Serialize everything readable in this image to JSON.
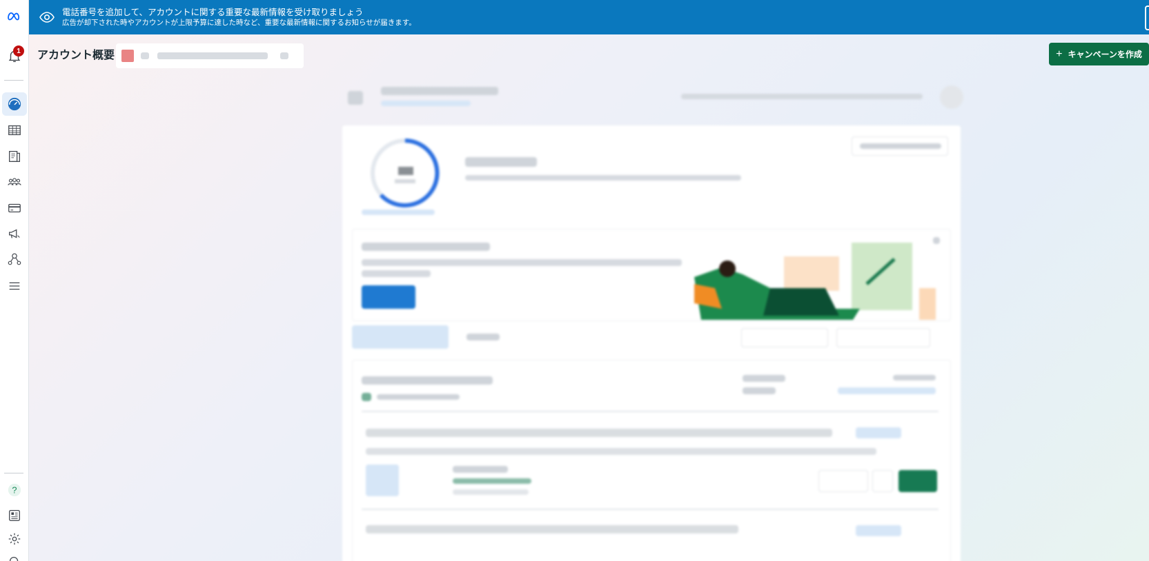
{
  "banner": {
    "line1": "電話番号を追加して、アカウントに関する重要な最新情報を受け取りましょう",
    "line2": "広告が却下された時やアカウントが上限予算に達した時など、重要な最新情報に関するお知らせが届きます。"
  },
  "header": {
    "title": "アカウント概要",
    "create_button": "キャンペーンを作成"
  },
  "rail": {
    "notification_count": "1",
    "items": [
      "meta-logo-icon",
      "bell-icon",
      "dashboard-icon",
      "table-icon",
      "pages-icon",
      "audience-icon",
      "billing-icon",
      "ads-icon",
      "network-icon",
      "menu-icon",
      "help-icon",
      "news-icon",
      "gear-icon",
      "search-icon"
    ]
  },
  "colors": {
    "banner": "#0a78be",
    "accent_green": "#0c6e45",
    "badge_red": "#c00f0f"
  }
}
